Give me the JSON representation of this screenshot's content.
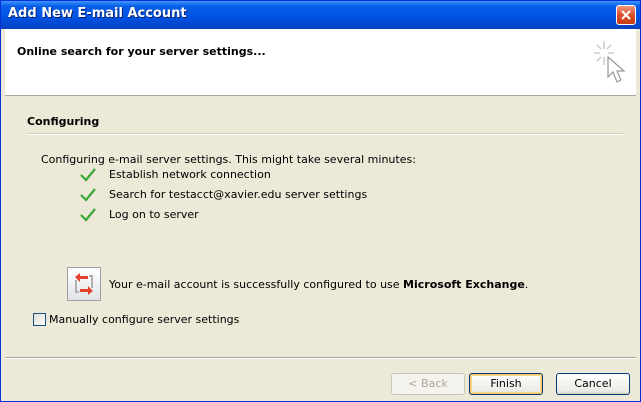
{
  "window": {
    "title": "Add New E-mail Account"
  },
  "header": {
    "title": "Online search for your server settings...",
    "icon": "cursor-sparkle-icon"
  },
  "section": {
    "title": "Configuring",
    "status": "Configuring e-mail server settings. This might take several minutes:"
  },
  "steps": [
    {
      "label": "Establish network connection",
      "state": "done"
    },
    {
      "label": "Search for testacct@xavier.edu server settings",
      "state": "done"
    },
    {
      "label": "Log on to server",
      "state": "done"
    }
  ],
  "success": {
    "prefix": "Your e-mail account is successfully configured to use ",
    "product": "Microsoft Exchange",
    "suffix": ".",
    "icon": "exchange-icon"
  },
  "manual_config": {
    "label": "Manually configure server settings",
    "checked": false
  },
  "buttons": {
    "back": "< Back",
    "finish": "Finish",
    "cancel": "Cancel"
  },
  "colors": {
    "title_bar": "#0055e5",
    "check": "#3aa635",
    "dialog_bg": "#ece9d8"
  }
}
